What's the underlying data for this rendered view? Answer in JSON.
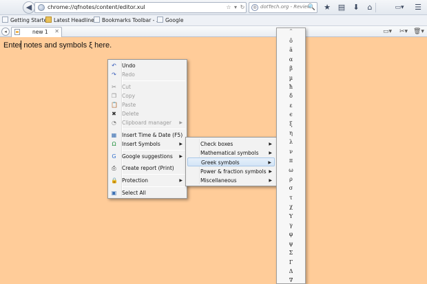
{
  "browser": {
    "url": "chrome://qfnotes/content/editor.xul",
    "search_placeholder": "dotTech.org - Review",
    "search_engine_glyph": "◎",
    "search_go_glyph": "🔍",
    "url_controls": [
      "☆",
      "▾",
      "↻"
    ],
    "nav_icons": [
      {
        "name": "bookmark-star-icon",
        "glyph": "★"
      },
      {
        "name": "bookmarks-list-icon",
        "glyph": "▤"
      },
      {
        "name": "downloads-icon",
        "glyph": "⬇"
      },
      {
        "name": "home-icon",
        "glyph": "⌂"
      },
      {
        "name": "addon-menu-icon",
        "glyph": "▭▾"
      },
      {
        "name": "menu-icon",
        "glyph": "☰"
      }
    ],
    "back_glyph": "◀"
  },
  "bookmarks": [
    {
      "label": "Getting Started",
      "icon": "page"
    },
    {
      "label": "Latest Headlines",
      "icon": "folder"
    },
    {
      "label": "Bookmarks Toolbar - ...",
      "icon": "page"
    },
    {
      "label": "Google",
      "icon": "page"
    }
  ],
  "tab": {
    "label": "new 1",
    "close": "✕"
  },
  "tabstrip_icons": [
    {
      "name": "open-folder-icon",
      "glyph": "▭▾"
    },
    {
      "name": "tools-icon",
      "glyph": "✂▾"
    },
    {
      "name": "trash-icon",
      "glyph": "🗑▾"
    }
  ],
  "editor": {
    "text": "Enter notes and symbols ξ here."
  },
  "context_menu": [
    {
      "label": "Undo",
      "icon": "↶",
      "icon_color": "#2f55b8",
      "disabled": false,
      "arrow": false
    },
    {
      "label": "Redo",
      "icon": "↷",
      "icon_color": "#2f55b8",
      "disabled": true,
      "arrow": false
    },
    {
      "label": "Cut",
      "icon": "✂",
      "icon_color": "#8a8a8a",
      "disabled": true,
      "arrow": false
    },
    {
      "label": "Copy",
      "icon": "❐",
      "icon_color": "#8a8a8a",
      "disabled": true,
      "arrow": false
    },
    {
      "label": "Paste",
      "icon": "📋",
      "icon_color": "#8a8a8a",
      "disabled": true,
      "arrow": false
    },
    {
      "label": "Delete",
      "icon": "✖",
      "icon_color": "#333333",
      "disabled": true,
      "arrow": false
    },
    {
      "label": "Clipboard manager",
      "icon": "◔",
      "icon_color": "#8a8a8a",
      "disabled": true,
      "arrow": true
    },
    {
      "label": "Insert Time & Date (F5)",
      "icon": "▦",
      "icon_color": "#3a6fb3",
      "disabled": false,
      "arrow": false
    },
    {
      "label": "Insert Symbols",
      "icon": "Ω",
      "icon_color": "#1e8f3b",
      "disabled": false,
      "arrow": true
    },
    {
      "label": "Google suggestions",
      "icon": "G",
      "icon_color": "#3470cc",
      "disabled": false,
      "arrow": true
    },
    {
      "label": "Create report (Print)",
      "icon": "⎙",
      "icon_color": "#444444",
      "disabled": false,
      "arrow": false
    },
    {
      "label": "Protection",
      "icon": "🔒",
      "icon_color": "#c89a1d",
      "disabled": false,
      "arrow": true
    },
    {
      "label": "Select All",
      "icon": "▣",
      "icon_color": "#3a6fb3",
      "disabled": false,
      "arrow": false
    }
  ],
  "symbols_menu": [
    {
      "label": "Check boxes",
      "highlighted": false
    },
    {
      "label": "Mathematical symbols",
      "highlighted": false
    },
    {
      "label": "Greek symbols",
      "highlighted": true
    },
    {
      "label": "Power & fraction symbols",
      "highlighted": false
    },
    {
      "label": "Miscellaneous",
      "highlighted": false
    }
  ],
  "submenu_arrow": "▶",
  "greek_palette": {
    "top_glyph": "^",
    "symbols": [
      "ô",
      "ä",
      "α",
      "β",
      "µ",
      "ħ",
      "δ",
      "ε",
      "ϵ",
      "ξ",
      "η",
      "λ",
      "ν",
      "π",
      "ω",
      "ρ",
      "σ",
      "τ",
      "χ",
      "Υ",
      "γ",
      "φ",
      "ψ",
      "Σ",
      "Γ",
      "Δ",
      "∇"
    ]
  }
}
